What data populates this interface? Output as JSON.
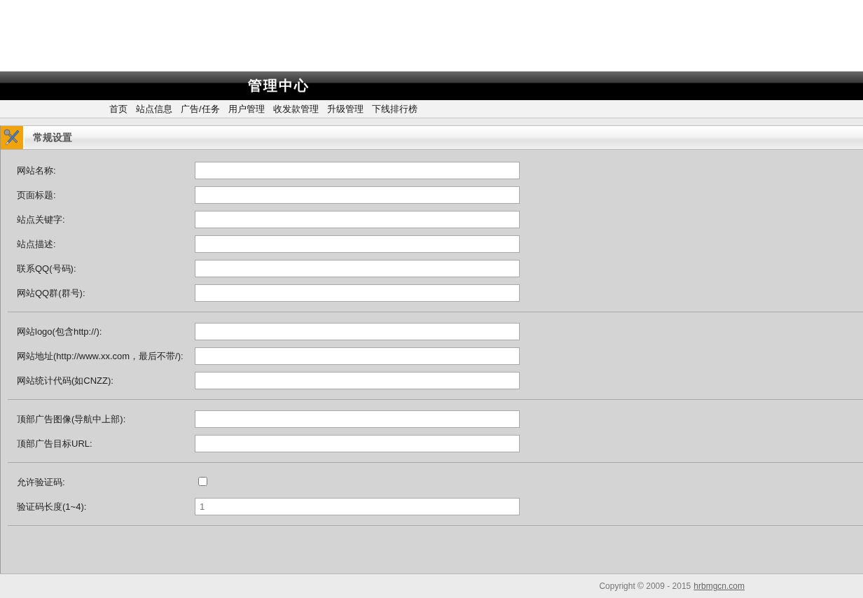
{
  "header": {
    "title": "管理中心"
  },
  "nav": {
    "items": [
      "首页",
      "站点信息",
      "广告/任务",
      "用户管理",
      "收发款管理",
      "升级管理",
      "下线排行榜"
    ]
  },
  "panel": {
    "title": "常规设置",
    "groups": [
      {
        "fields": [
          {
            "kind": "text",
            "label": "网站名称:"
          },
          {
            "kind": "text",
            "label": "页面标题:"
          },
          {
            "kind": "text",
            "label": "站点关键字:"
          },
          {
            "kind": "text",
            "label": "站点描述:"
          },
          {
            "kind": "text",
            "label": "联系QQ(号码):"
          },
          {
            "kind": "text",
            "label": "网站QQ群(群号):"
          }
        ]
      },
      {
        "fields": [
          {
            "kind": "text",
            "label": "网站logo(包含http://):"
          },
          {
            "kind": "text",
            "label": "网站地址(http://www.xx.com，最后不带/):"
          },
          {
            "kind": "text",
            "label": "网站统计代码(如CNZZ):"
          }
        ]
      },
      {
        "fields": [
          {
            "kind": "text",
            "label": "顶部广告图像(导航中上部):"
          },
          {
            "kind": "text",
            "label": "顶部广告目标URL:"
          }
        ]
      },
      {
        "fields": [
          {
            "kind": "checkbox",
            "label": "允许验证码:",
            "checked": false
          },
          {
            "kind": "text",
            "label": "验证码长度(1~4):",
            "value": "1"
          }
        ]
      }
    ]
  },
  "footer": {
    "copyright": "Copyright © 2009 - 2015",
    "link": "hrbmgcn.com"
  }
}
